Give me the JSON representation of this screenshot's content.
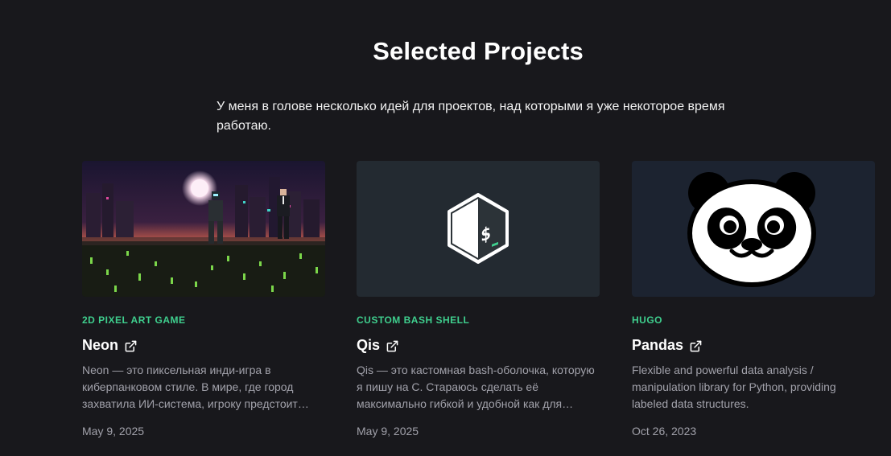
{
  "section": {
    "title": "Selected Projects",
    "intro": "У меня в голове несколько идей для проектов, над которыми я уже некоторое время работаю."
  },
  "colors": {
    "background": "#18181c",
    "accent": "#3fcf8e",
    "muted_text": "#a1a1aa"
  },
  "projects": [
    {
      "tag": "2D PIXEL ART GAME",
      "title": "Neon",
      "description": "Neon — это пиксельная инди-игра в киберпанковом стиле. В мире, где город захватила ИИ-система, игроку предстоит…",
      "date": "May 9, 2025",
      "image": "pixel-art-cyberpunk-scene",
      "link_icon": "external-link-icon"
    },
    {
      "tag": "CUSTOM BASH SHELL",
      "title": "Qis",
      "description": "Qis — это кастомная bash-оболочка, которую я пишу на C. Стараюсь сделать её максимально гибкой и удобной как для…",
      "date": "May 9, 2025",
      "image": "bash-logo",
      "link_icon": "external-link-icon"
    },
    {
      "tag": "HUGO",
      "title": "Pandas",
      "description": "Flexible and powerful data analysis / manipulation library for Python, providing labeled data structures.",
      "date": "Oct 26, 2023",
      "image": "panda-face",
      "link_icon": "external-link-icon"
    }
  ]
}
